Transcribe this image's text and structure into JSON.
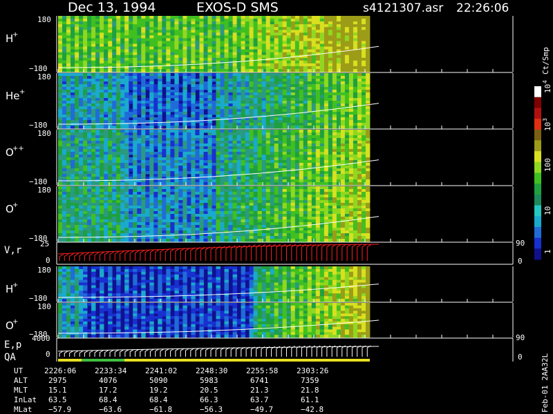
{
  "header": {
    "date": "Dec 13, 1994",
    "mission": "EXOS-D SMS",
    "file": "s4121307.asr",
    "time": "22:26:06"
  },
  "colorbar": {
    "unit_label": "Ct/Smp",
    "ticks": [
      {
        "value": "1",
        "sup": ""
      },
      {
        "value": "10",
        "sup": ""
      },
      {
        "value": "100",
        "sup": ""
      },
      {
        "value": "10",
        "sup": "3"
      },
      {
        "value": "10",
        "sup": "4"
      }
    ],
    "colors": [
      "#10108c",
      "#1830d0",
      "#1f6cd8",
      "#19aacd",
      "#24c8c0",
      "#1a8a5a",
      "#1fa040",
      "#40c020",
      "#90d820",
      "#d8e020",
      "#9c9c18",
      "#7a6010",
      "#e03010",
      "#b01010",
      "#800000",
      "#ffffff"
    ]
  },
  "panels": [
    {
      "label": "H",
      "sup": "+",
      "ymax": "180",
      "ymin": "−180",
      "intensity": 0.62
    },
    {
      "label": "He",
      "sup": "+",
      "ymax": "180",
      "ymin": "−180",
      "intensity": 0.35
    },
    {
      "label": "O",
      "sup": "++",
      "ymax": "180",
      "ymin": "−180",
      "intensity": 0.42
    },
    {
      "label": "O",
      "sup": "+",
      "ymax": "180",
      "ymin": "−180",
      "intensity": 0.45
    },
    {
      "label": "H",
      "sup": "+",
      "ymax": "180",
      "ymin": "−180",
      "intensity": 0.28
    },
    {
      "label": "O",
      "sup": "+",
      "ymax": "180",
      "ymin": "−180",
      "intensity": 0.22
    }
  ],
  "vr_panel": {
    "label": "V,r",
    "ytop": "25",
    "ybot": "0",
    "right_top": "90",
    "right_bot": "0"
  },
  "ep_panel": {
    "label1": "E,p",
    "label2": "QA",
    "ytop": "4000",
    "ybot": "0",
    "right_top": "90",
    "right_bot": "0"
  },
  "table": {
    "row_labels": [
      "UT",
      "ALT",
      "MLT",
      "InLat",
      "MLat"
    ],
    "columns": [
      [
        "2226:06",
        "2975",
        "15.1",
        "63.5",
        "−57.9"
      ],
      [
        "2233:34",
        "4076",
        "17.2",
        "68.4",
        "−63.6"
      ],
      [
        "2241:02",
        "5090",
        "19.2",
        "68.4",
        "−61.8"
      ],
      [
        "2248:30",
        "5983",
        "20.5",
        "66.3",
        "−56.3"
      ],
      [
        "2255:58",
        "6741",
        "21.3",
        "63.7",
        "−49.7"
      ],
      [
        "2303:26",
        "7359",
        "21.8",
        "61.1",
        "−42.8"
      ]
    ]
  },
  "side_note": "Feb-01 2AA32L",
  "chart_data": {
    "type": "heatmap",
    "title": "Dec 13, 1994   EXOS-D SMS",
    "x_ticks": [
      "2226:06",
      "2233:34",
      "2241:02",
      "2248:30",
      "2255:58",
      "2303:26"
    ],
    "panel_labels": [
      "H+",
      "He+",
      "O++",
      "O+",
      "V,r",
      "H+",
      "O+",
      "E,p QA"
    ],
    "ylim": [
      -180,
      180
    ],
    "colorbar_ticks": [
      "1",
      "10",
      "100",
      "10^3",
      "10^4"
    ],
    "colorbar_unit": "Ct/Smp"
  }
}
